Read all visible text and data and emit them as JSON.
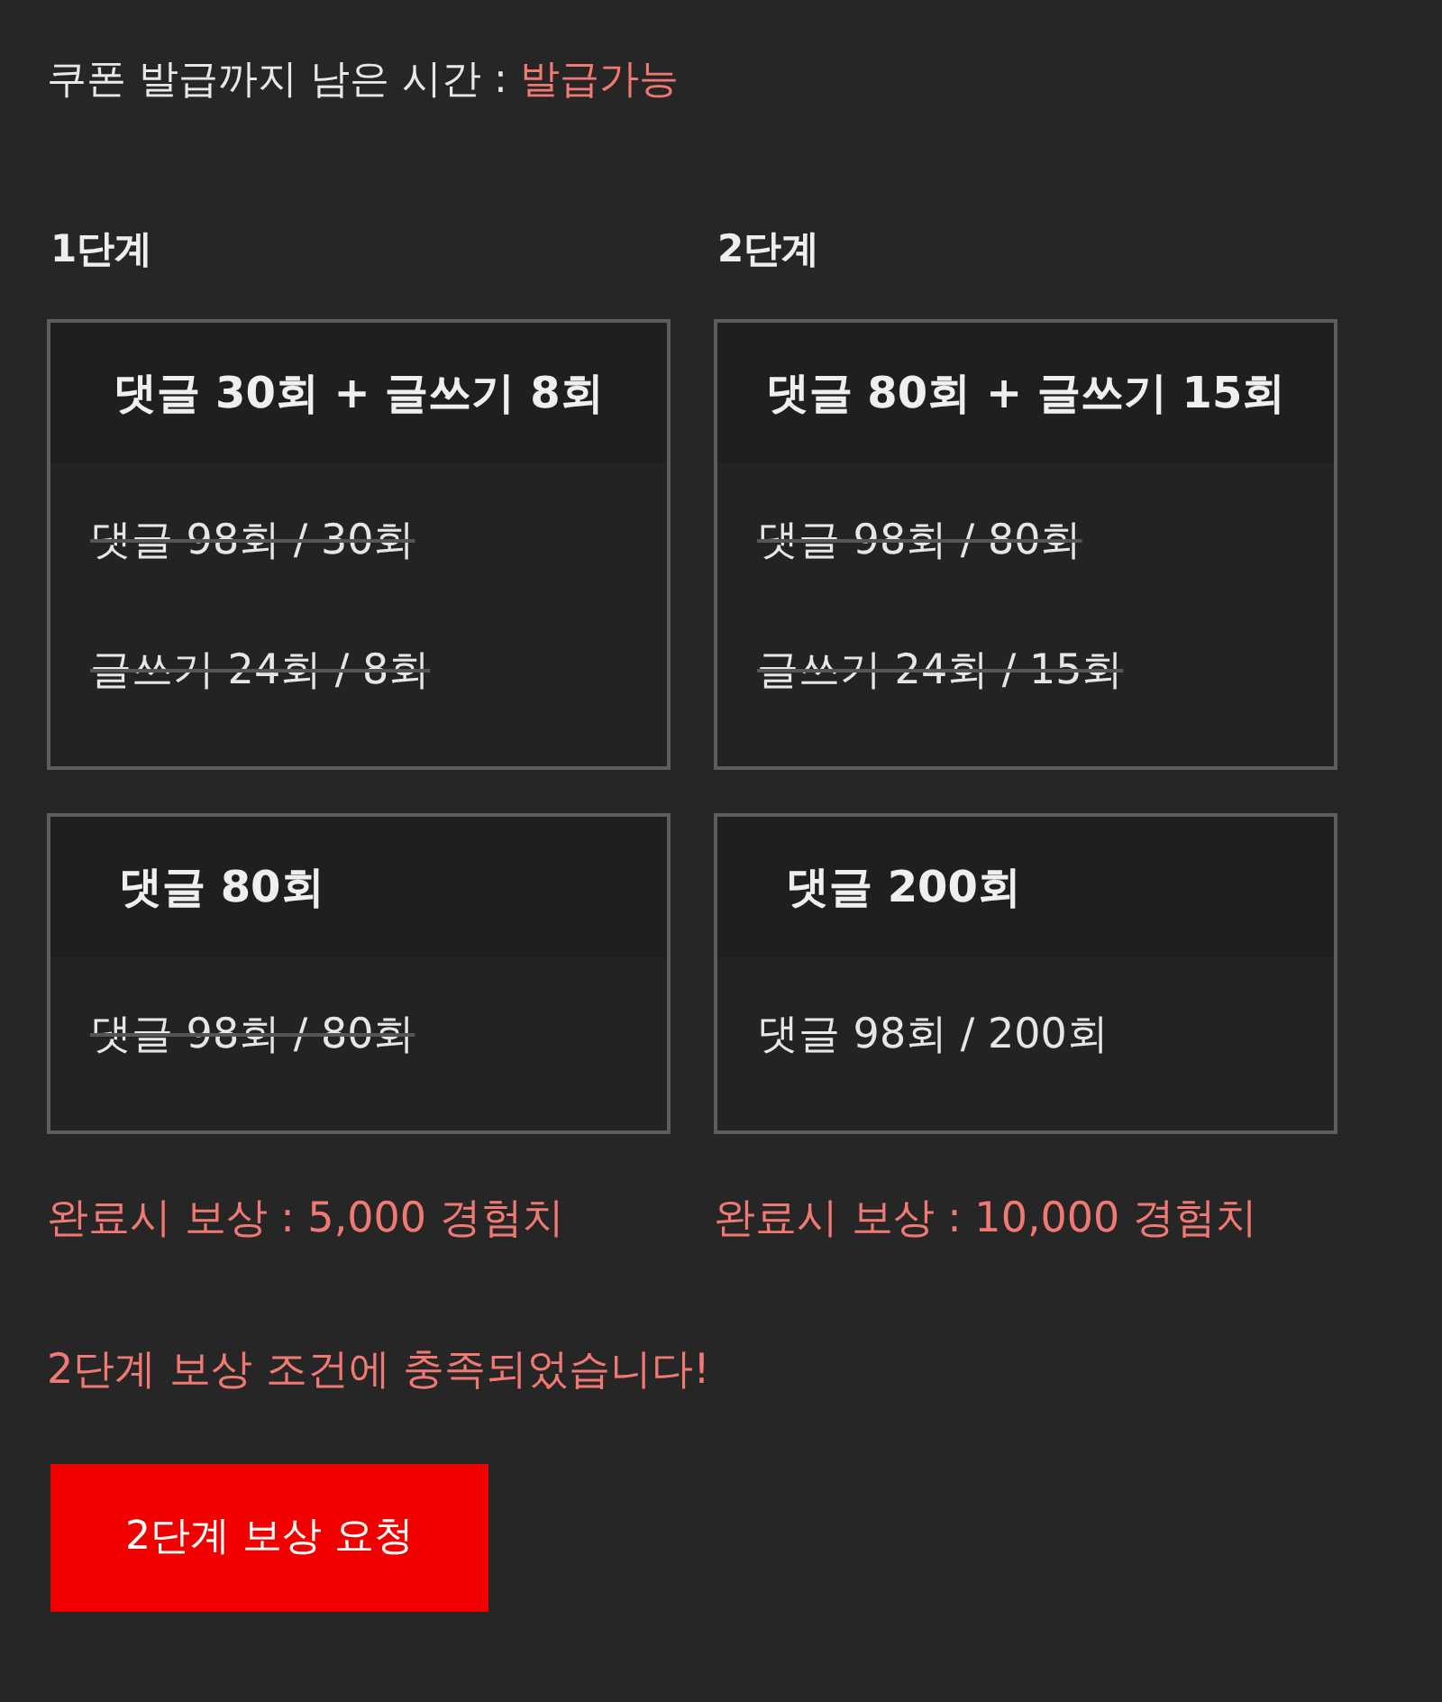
{
  "coupon": {
    "label": "쿠폰 발급까지 남은 시간 : ",
    "status": "발급가능"
  },
  "stages": [
    {
      "title": "1단계",
      "missions": [
        {
          "heading": "댓글 30회 + 글쓰기 8회",
          "rows": [
            {
              "text": "댓글 98회 / 30회",
              "done": true
            },
            {
              "text": "글쓰기 24회 / 8회",
              "done": true
            }
          ]
        },
        {
          "heading": "댓글 80회",
          "rows": [
            {
              "text": "댓글 98회 / 80회",
              "done": true
            }
          ]
        }
      ],
      "reward": "완료시 보상 : 5,000 경험치"
    },
    {
      "title": "2단계",
      "missions": [
        {
          "heading": "댓글 80회 + 글쓰기 15회",
          "rows": [
            {
              "text": "댓글 98회 / 80회",
              "done": true
            },
            {
              "text": "글쓰기 24회 / 15회",
              "done": true
            }
          ]
        },
        {
          "heading": "댓글 200회",
          "rows": [
            {
              "text": "댓글 98회 / 200회",
              "done": false
            }
          ]
        }
      ],
      "reward": "완료시 보상 : 10,000 경험치"
    }
  ],
  "message": "2단계 보상 조건에 충족되었습니다!",
  "button": "2단계 보상 요청"
}
